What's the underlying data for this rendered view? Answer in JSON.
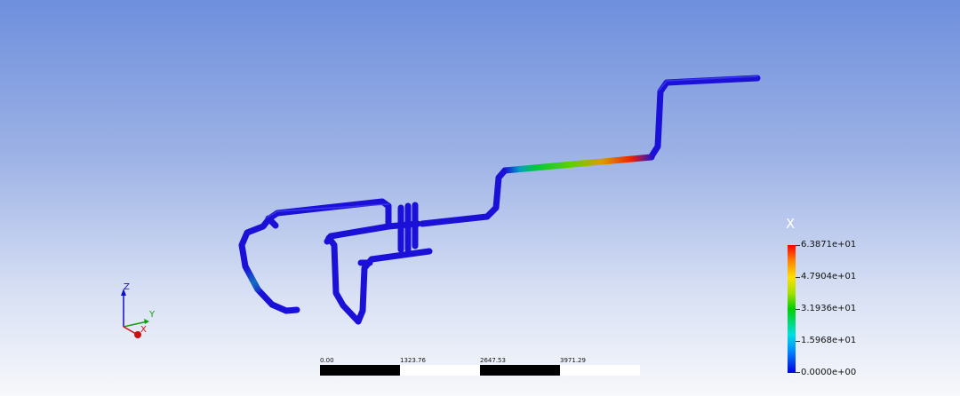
{
  "legend": {
    "title": "X",
    "labels": [
      "6.3871e+01",
      "4.7904e+01",
      "3.1936e+01",
      "1.5968e+01",
      "0.0000e+00"
    ],
    "max": 63.871,
    "min": 0.0
  },
  "scale_bar": {
    "labels": [
      "0.00",
      "1323.76",
      "2647.53",
      "3971.29"
    ]
  },
  "triad": {
    "z": "Z",
    "y": "Y",
    "x": "X"
  },
  "colors": {
    "pipe": "#1a10d8",
    "max": "#ff0000",
    "mid": "#00d000",
    "min": "#0000e0"
  }
}
